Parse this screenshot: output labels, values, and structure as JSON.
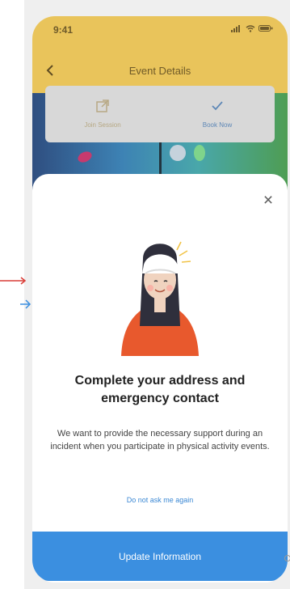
{
  "status_bar": {
    "time": "9:41",
    "icons": [
      "signal-icon",
      "wifi-icon",
      "battery-icon"
    ]
  },
  "nav": {
    "title": "Event Details",
    "back_icon": "back-icon"
  },
  "actions": {
    "left_label": "Join Session",
    "right_label": "Book Now"
  },
  "modal": {
    "title": "Complete your address and emergency contact",
    "body": "We want to provide the necessary support during an incident when you participate in physical activity events.",
    "skip_label": "Do not ask me again",
    "cta_label": "Update Information"
  },
  "colors": {
    "header": "#e9c45b",
    "primary": "#3b8fe0",
    "accent_red": "#d93c36"
  }
}
